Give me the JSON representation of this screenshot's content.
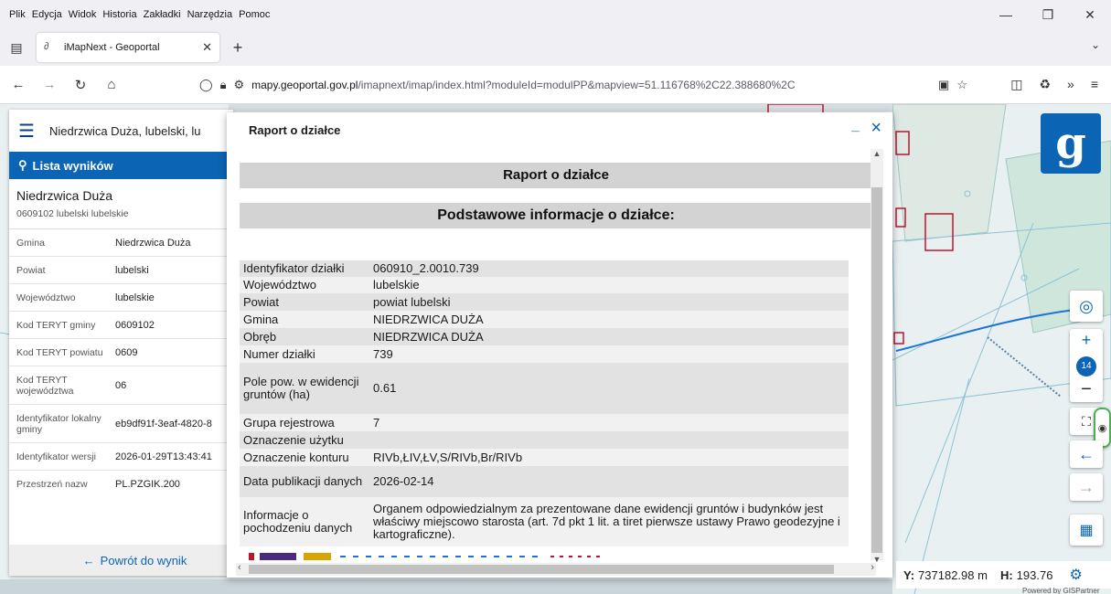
{
  "browser": {
    "menu": [
      "Plik",
      "Edycja",
      "Widok",
      "Historia",
      "Zakładki",
      "Narzędzia",
      "Pomoc"
    ],
    "tab_title": "iMapNext - Geoportal",
    "url_host": "mapy.geoportal.gov.pl",
    "url_path": "/imapnext/imap/index.html?moduleId=modulPP&mapview=51.116768%2C22.388680%2C"
  },
  "left_panel": {
    "location_title": "Niedrzwica Duża, lubelski, lu",
    "results_label": "Lista wyników",
    "place_name": "Niedrzwica Duża",
    "place_sub": "0609102 lubelski lubelskie",
    "attributes": [
      {
        "key": "Gmina",
        "value": "Niedrzwica Duża"
      },
      {
        "key": "Powiat",
        "value": "lubelski"
      },
      {
        "key": "Województwo",
        "value": "lubelskie"
      },
      {
        "key": "Kod TERYT gminy",
        "value": "0609102"
      },
      {
        "key": "Kod TERYT powiatu",
        "value": "0609"
      },
      {
        "key": "Kod TERYT województwa",
        "value": "06"
      },
      {
        "key": "Identyfikator lokalny gminy",
        "value": "eb9df91f-3eaf-4820-8"
      },
      {
        "key": "Identyfikator wersji",
        "value": "2026-01-29T13:43:41"
      },
      {
        "key": "Przestrzeń nazw",
        "value": "PL.PZGIK.200"
      }
    ],
    "back_label": "Powrót do wynik"
  },
  "modal": {
    "title": "Raport o działce",
    "min_symbol": "_",
    "close_symbol": "×",
    "report_heading": "Raport o działce",
    "section_heading": "Podstawowe informacje o działce:",
    "rows": [
      {
        "key": "Identyfikator działki",
        "value": "060910_2.0010.739"
      },
      {
        "key": "Województwo",
        "value": "lubelskie"
      },
      {
        "key": "Powiat",
        "value": "powiat lubelski"
      },
      {
        "key": "Gmina",
        "value": "NIEDRZWICA DUŻA"
      },
      {
        "key": "Obręb",
        "value": "NIEDRZWICA DUŻA"
      },
      {
        "key": "Numer działki",
        "value": "739"
      },
      {
        "key": "Pole pow. w ewidencji gruntów (ha)",
        "value": "0.61"
      },
      {
        "key": "Grupa rejestrowa",
        "value": "7"
      },
      {
        "key": "Oznaczenie użytku",
        "value": ""
      },
      {
        "key": "Oznaczenie konturu",
        "value": "RIVb,ŁIV,ŁV,S/RIVb,Br/RIVb"
      },
      {
        "key": "Data publikacji danych",
        "value": "2026-02-14"
      },
      {
        "key": "Informacje o pochodzeniu danych",
        "value": "Organem odpowiedzialnym za prezentowane dane ewidencji gruntów i budynków jest właściwy miejscowo starosta (art. 7d pkt 1 lit. a tiret pierwsze ustawy Prawo geodezyjne i kartograficzne)."
      }
    ]
  },
  "map": {
    "zoom_level": "14",
    "coord_y_label": "Y:",
    "coord_y_value": "737182.98 m",
    "coord_h_label": "H:",
    "coord_h_value": "193.76",
    "powered_by": "Powered by GISPartner"
  },
  "colors": {
    "accent": "#0b64b4",
    "parcel": "#c0132e",
    "water": "#1e73d6"
  }
}
